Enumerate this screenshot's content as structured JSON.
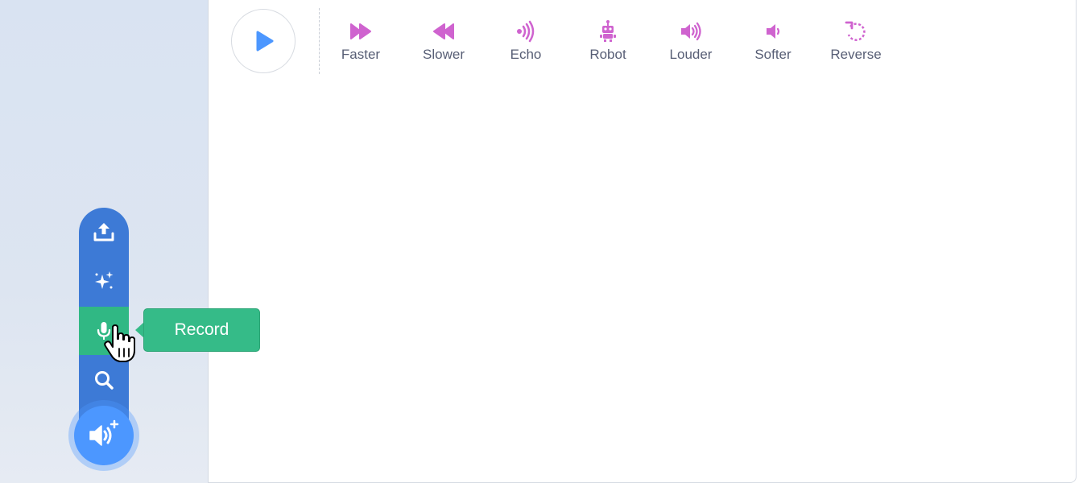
{
  "effects": [
    {
      "label": "Faster",
      "icon": "faster-icon"
    },
    {
      "label": "Slower",
      "icon": "slower-icon"
    },
    {
      "label": "Echo",
      "icon": "echo-icon"
    },
    {
      "label": "Robot",
      "icon": "robot-icon"
    },
    {
      "label": "Louder",
      "icon": "louder-icon"
    },
    {
      "label": "Softer",
      "icon": "softer-icon"
    },
    {
      "label": "Reverse",
      "icon": "reverse-icon"
    }
  ],
  "sound_menu": {
    "items": [
      {
        "icon": "upload-icon"
      },
      {
        "icon": "surprise-sparkle-icon"
      },
      {
        "icon": "microphone-icon",
        "active": true
      },
      {
        "icon": "search-icon"
      }
    ],
    "tooltip": "Record",
    "main_button_icon": "add-sound-icon"
  },
  "colors": {
    "effect_icon": "#cf63cf",
    "menu_bg": "#3d7ad6",
    "menu_active": "#30b884",
    "tooltip_bg": "#35bb88",
    "main_button": "#4c97ff",
    "play_icon": "#4c97ff",
    "label_text": "#575e75"
  }
}
